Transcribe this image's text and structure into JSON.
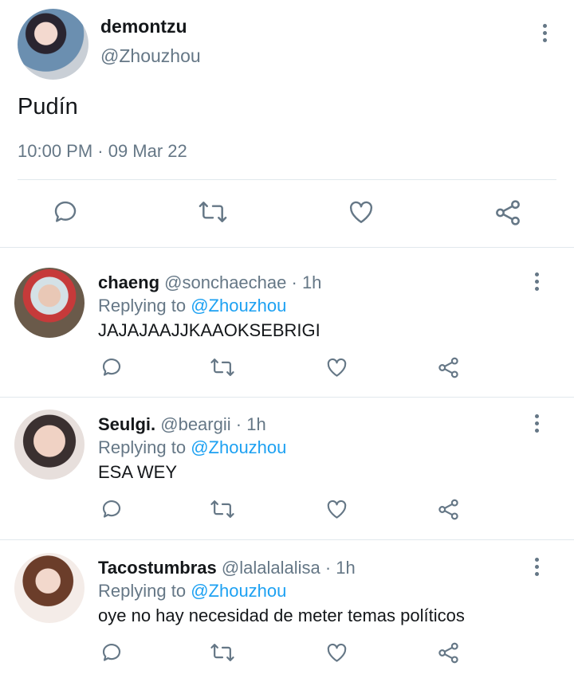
{
  "main_tweet": {
    "display_name": "demontzu",
    "handle": "@Zhouzhou",
    "text": "Pudín",
    "timestamp": "10:00 PM · 09 Mar 22",
    "actions": [
      "reply-icon",
      "retweet-icon",
      "like-icon",
      "share-icon"
    ]
  },
  "replies": [
    {
      "display_name": "chaeng",
      "handle": "@sonchaechae",
      "time": "· 1h",
      "replying_prefix": "Replying to",
      "replying_to": "@Zhouzhou",
      "text": "JAJAJAAJJKAAOKSEBRIGI"
    },
    {
      "display_name": "Seulgi.",
      "handle": "@beargii",
      "time": "· 1h",
      "replying_prefix": "Replying to",
      "replying_to": "@Zhouzhou",
      "text": "ESA WEY"
    },
    {
      "display_name": "Tacostumbras",
      "handle": "@lalalalalisa",
      "time": "· 1h",
      "replying_prefix": "Replying to",
      "replying_to": "@Zhouzhou",
      "text": "oye no hay necesidad de meter temas políticos"
    }
  ],
  "colors": {
    "text": "#14171a",
    "muted": "#657786",
    "accent": "#1da1f2",
    "divider": "#e1e8ed"
  }
}
